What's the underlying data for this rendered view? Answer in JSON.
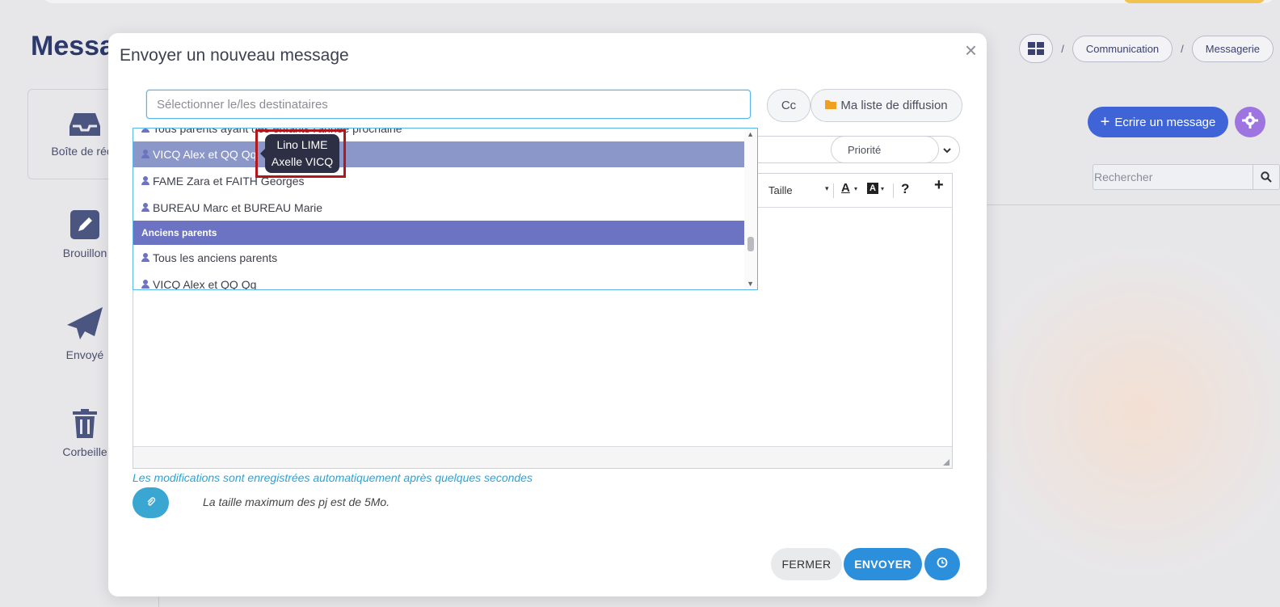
{
  "background": {
    "page_title": "Messa",
    "breadcrumb": [
      "Communication",
      "Messagerie"
    ],
    "breadcrumb_separator": "/",
    "sidebar": [
      {
        "label": "Boîte de réce",
        "icon": "inbox-icon"
      },
      {
        "label": "Brouillon",
        "icon": "pencil-icon"
      },
      {
        "label": "Envoyé",
        "icon": "paper-plane-icon"
      },
      {
        "label": "Corbeille",
        "icon": "trash-icon"
      }
    ],
    "write_button": "Ecrire un message",
    "search_placeholder": "Rechercher"
  },
  "modal": {
    "title": "Envoyer un nouveau message",
    "close_symbol": "×",
    "recipient_placeholder": "Sélectionner le/les destinataires",
    "cc_label": "Cc",
    "broadcast_label": "Ma liste de diffusion",
    "priority_label": "Priorité",
    "toolbar": {
      "size_label": "Taille",
      "font_color_label": "A",
      "bg_color_label": "A",
      "help_label": "?",
      "more_label": "+"
    },
    "autosave_note": "Les modifications sont enregistrées automatiquement après quelques secondes",
    "attachment_note": "La taille maximum des pj est de 5Mo.",
    "close_button": "FERMER",
    "send_button": "ENVOYER"
  },
  "dropdown": {
    "items": [
      {
        "label": "Tous parents ayant des enfants l'année prochaine",
        "type": "option"
      },
      {
        "label": "VICQ Alex et QQ Qq",
        "type": "option-selected"
      },
      {
        "label": "FAME Zara et FAITH Georges",
        "type": "option"
      },
      {
        "label": "BUREAU Marc et BUREAU Marie",
        "type": "option"
      },
      {
        "label": "Anciens parents",
        "type": "group"
      },
      {
        "label": "Tous les anciens parents",
        "type": "option"
      },
      {
        "label": "VICQ Alex et QQ Qq",
        "type": "option"
      }
    ]
  },
  "tooltip": {
    "lines": [
      "Lino LIME",
      "Axelle VICQ"
    ]
  },
  "colors": {
    "accent_blue": "#2c8fdc",
    "write_button": "#3f64d8",
    "group_header": "#6b73c2",
    "selected_row": "#8a97c8",
    "highlight_frame": "#b0181c",
    "autosave_text": "#2aa3d8"
  }
}
